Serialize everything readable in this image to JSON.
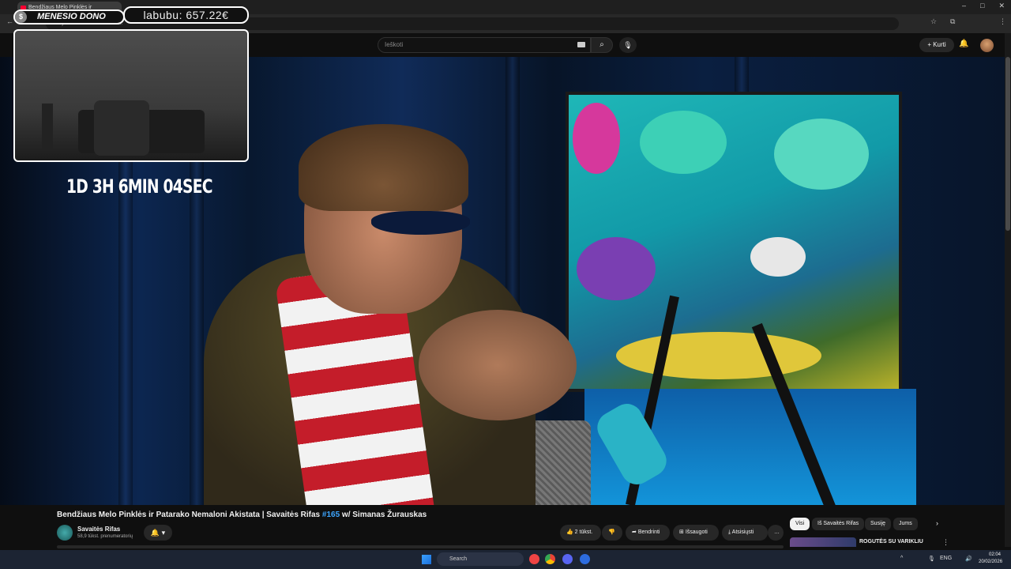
{
  "browser": {
    "tab_title": "Bendžiaus Melo Pinklės ir",
    "url": "youtube.com/watch?v=...",
    "window_controls": [
      "–",
      "□",
      "✕"
    ]
  },
  "youtube": {
    "search_placeholder": "Ieškoti",
    "create_label": "Kurti"
  },
  "overlay": {
    "donor_label": "MENESIO DONO",
    "amount": "labubu: 657.22€",
    "timer": "1D 3H 6MIN 04SEC"
  },
  "video": {
    "title_main": "Bendžiaus Melo Pinklės ir Patarako Nemaloni Akistata | Savaitės Rifas ",
    "title_tag": "#165",
    "title_rest": " w/ Simanas Žurauskas",
    "logo": "S"
  },
  "channel": {
    "name": "Savaitės Rifas",
    "subscribers": "58,9 tūkst. prenumeratorių"
  },
  "actions": {
    "likes": "2 tūkst.",
    "share": "Bendrinti",
    "save": "Išsaugoti",
    "download": "Atsisiųsti",
    "more": "…"
  },
  "chips": [
    "Visi",
    "Iš Savaitės Rifas",
    "Susiję",
    "Jums"
  ],
  "recommendation": {
    "title": "ROGUTĖS SU VARIKLIU"
  },
  "taskbar": {
    "search_label": "Search",
    "lang": "ENG",
    "time": "02:04",
    "date": "20/02/2026"
  },
  "icons": [
    "search-icon",
    "microphone-icon",
    "bell-icon",
    "like-icon",
    "dislike-icon",
    "share-icon",
    "save-icon",
    "download-icon",
    "windows-icon",
    "chevron-right-icon"
  ],
  "colors": {
    "accent_blue": "#3ea6ff",
    "youtube_red": "#ff0033",
    "background": "#0f0f0f"
  }
}
